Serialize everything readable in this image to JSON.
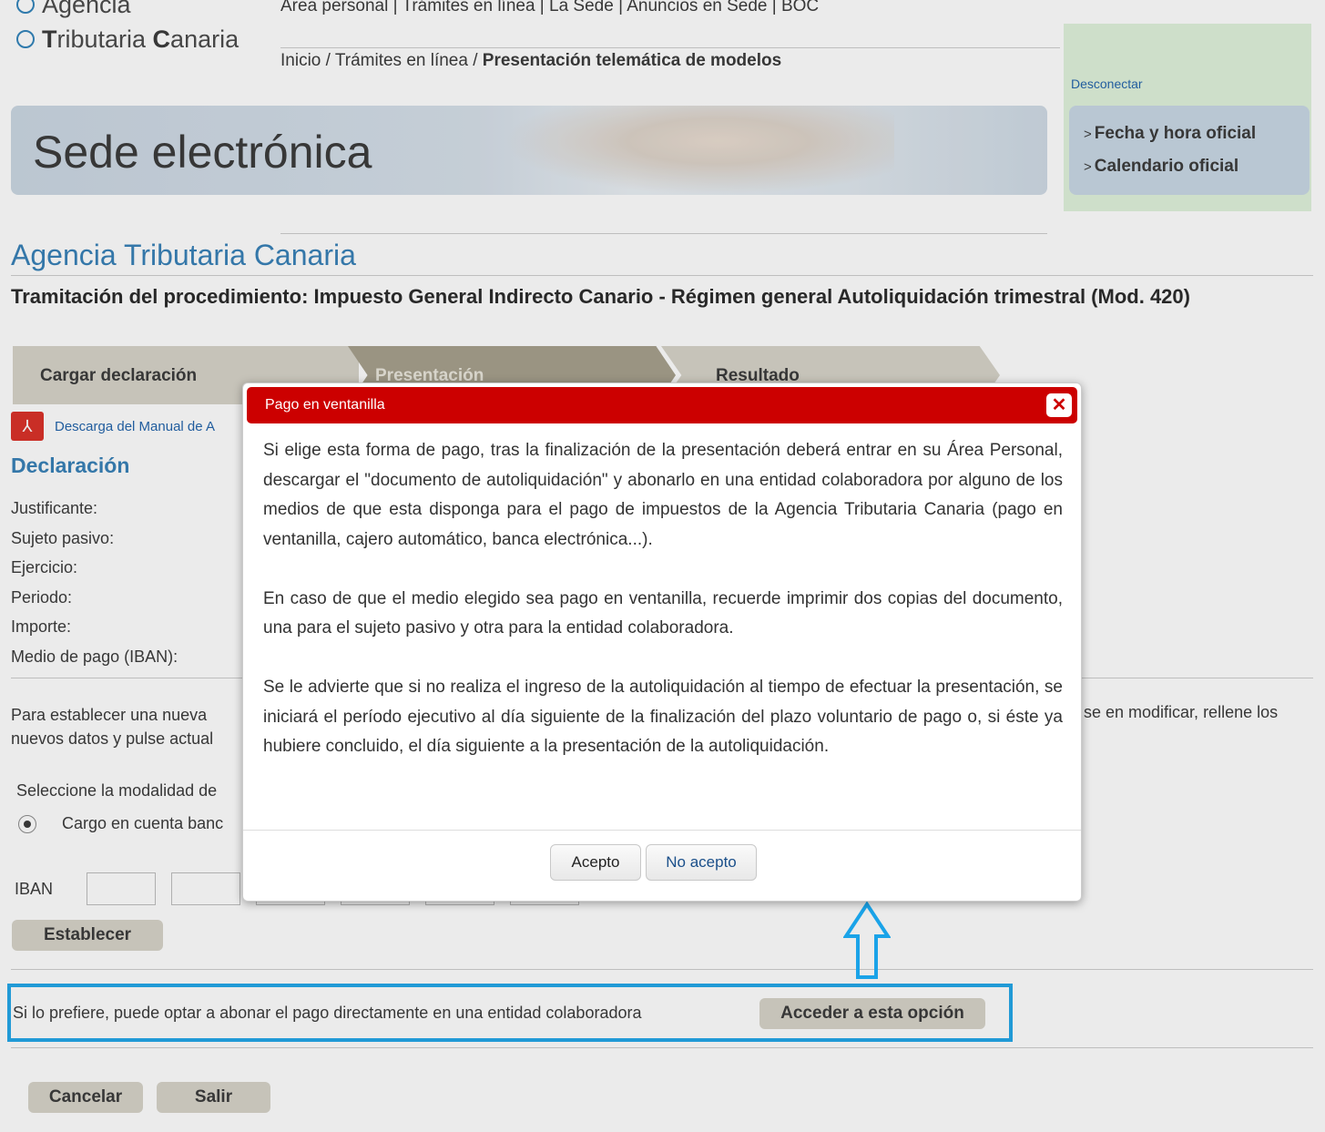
{
  "header": {
    "logo_line1": "Agencia",
    "logo_line2_a": "T",
    "logo_line2_b": "ributaria ",
    "logo_line2_c": "C",
    "logo_line2_d": "anaria",
    "topnav": "Área personal | Trámites en línea | La Sede | Anuncios en Sede | BOC",
    "breadcrumb": {
      "item1": "Inicio / ",
      "item2": "Trámites en línea / ",
      "current": "Presentación telemática de modelos"
    },
    "desconectar": "Desconectar",
    "side_links": [
      "Fecha y hora oficial",
      "Calendario oficial"
    ],
    "banner_title": "Sede electrónica"
  },
  "main": {
    "agency_title": "Agencia Tributaria Canaria",
    "procedure_title": "Tramitación del procedimiento: Impuesto General Indirecto Canario - Régimen general Autoliquidación trimestral (Mod. 420)",
    "steps": [
      "Cargar declaración",
      "Presentación",
      "Resultado"
    ],
    "manual_link": "Descarga del Manual de A",
    "declaration_title": "Declaración",
    "fields": [
      "Justificante:",
      "Sujeto pasivo:",
      "Ejercicio:",
      "Periodo:",
      "Importe:",
      "Medio de pago (IBAN):"
    ],
    "info_left_1": "Para establecer una nueva",
    "info_left_2": "nuevos datos y pulse actual",
    "info_right": "se en modificar, rellene los",
    "modalidad_label": "Seleccione la modalidad de",
    "radio_label": "Cargo en cuenta banc",
    "iban_label": "IBAN",
    "establecer_button": "Establecer",
    "prefer_text": "Si lo prefiere, puede optar a abonar el pago directamente en una entidad colaboradora",
    "access_button": "Acceder a esta opción",
    "cancel_button": "Cancelar",
    "exit_button": "Salir"
  },
  "modal": {
    "title": "Pago en ventanilla",
    "paragraph1": "Si elige esta forma de pago, tras la finalización de la presentación deberá entrar en su Área Personal, descargar el \"documento de autoliquidación\" y abonarlo en una entidad colaboradora por alguno de los medios de que esta disponga para el pago de impuestos de la Agencia Tributaria Canaria (pago en ventanilla, cajero automático, banca electrónica...).",
    "paragraph2": "En caso de que el medio elegido sea pago en ventanilla, recuerde imprimir dos copias del documento, una para el sujeto pasivo y otra para la entidad colaboradora.",
    "paragraph3": "Se le advierte que si no realiza el ingreso de la autoliquidación al tiempo de efectuar la presentación, se iniciará el período ejecutivo al día siguiente de la finalización del plazo voluntario de pago o, si éste ya hubiere concluido, el día siguiente a la presentación de la autoliquidación.",
    "accept_button": "Acepto",
    "reject_button": "No acepto"
  },
  "colors": {
    "modal_header": "#cc0000",
    "highlight_box": "#1aa3e8",
    "agency_blue": "#2f7cb4",
    "button_tan": "#d5d2c7"
  },
  "icons": {
    "close": "close-icon",
    "pdf": "pdf-icon",
    "arrow": "up-arrow-icon"
  }
}
